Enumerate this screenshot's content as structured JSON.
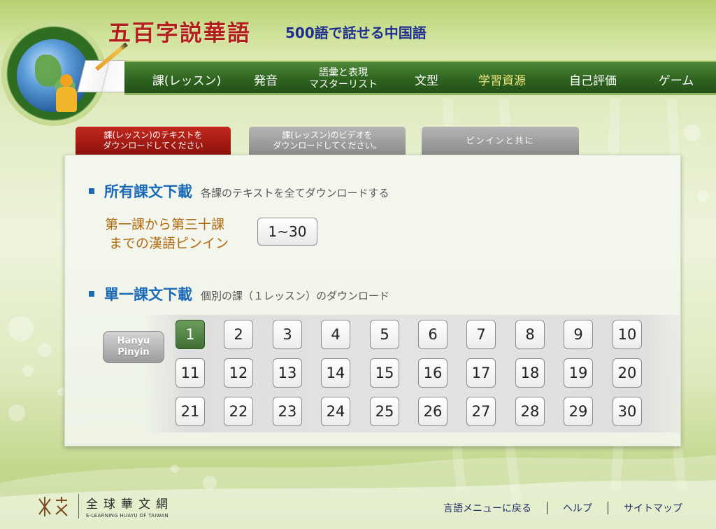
{
  "header": {
    "title_cn": "五百字説華語",
    "title_jp": "500語で話せる中国語"
  },
  "nav": [
    {
      "label": "課(レッスン)"
    },
    {
      "label": "発音"
    },
    {
      "label_line1": "語彙と表現",
      "label_line2": "マスターリスト"
    },
    {
      "label": "文型"
    },
    {
      "label": "学習資源",
      "active": true
    },
    {
      "label": "自己評価"
    },
    {
      "label": "ゲーム"
    }
  ],
  "tabs": [
    {
      "line1": "課(レッスン)のテキストを",
      "line2": "ダウンロードしてください",
      "active": true
    },
    {
      "line1": "課(レッスン)のビデオを",
      "line2": "ダウンロードしてください。",
      "active": false
    },
    {
      "line1": "ピンインと共に",
      "active": false
    }
  ],
  "all_download": {
    "title": "所有課文下載",
    "subtitle": "各課のテキストを全てダウンロードする",
    "range_label_line1": "第一課から第三十課",
    "range_label_line2": "までの漢語ピンイン",
    "range_button": "1~30"
  },
  "single_download": {
    "title": "單一課文下載",
    "subtitle": "個別の課（１レッスン）のダウンロード",
    "pinyin_line1": "Hanyu",
    "pinyin_line2": "Pinyin",
    "selected_lesson": "1",
    "lessons": [
      "1",
      "2",
      "3",
      "4",
      "5",
      "6",
      "7",
      "8",
      "9",
      "10",
      "11",
      "12",
      "13",
      "14",
      "15",
      "16",
      "17",
      "18",
      "19",
      "20",
      "21",
      "22",
      "23",
      "24",
      "25",
      "26",
      "27",
      "28",
      "29",
      "30"
    ]
  },
  "footer": {
    "logo_cn": "全球華文網",
    "logo_en": "E-LEARNING HUAYU OF TAIWAN",
    "links": [
      "言語メニューに戻る",
      "ヘルプ",
      "サイトマップ"
    ]
  },
  "colors": {
    "nav_green": "#2f6420",
    "active_nav": "#f2e77e",
    "tab_active": "#a31a13",
    "tab_inactive": "#9f9f9f",
    "section_blue": "#1a6ab8",
    "range_label": "#b26b12",
    "title_red": "#b21f1f",
    "title_blue": "#1f2e8c",
    "lesson_selected": "#4f7f42"
  }
}
